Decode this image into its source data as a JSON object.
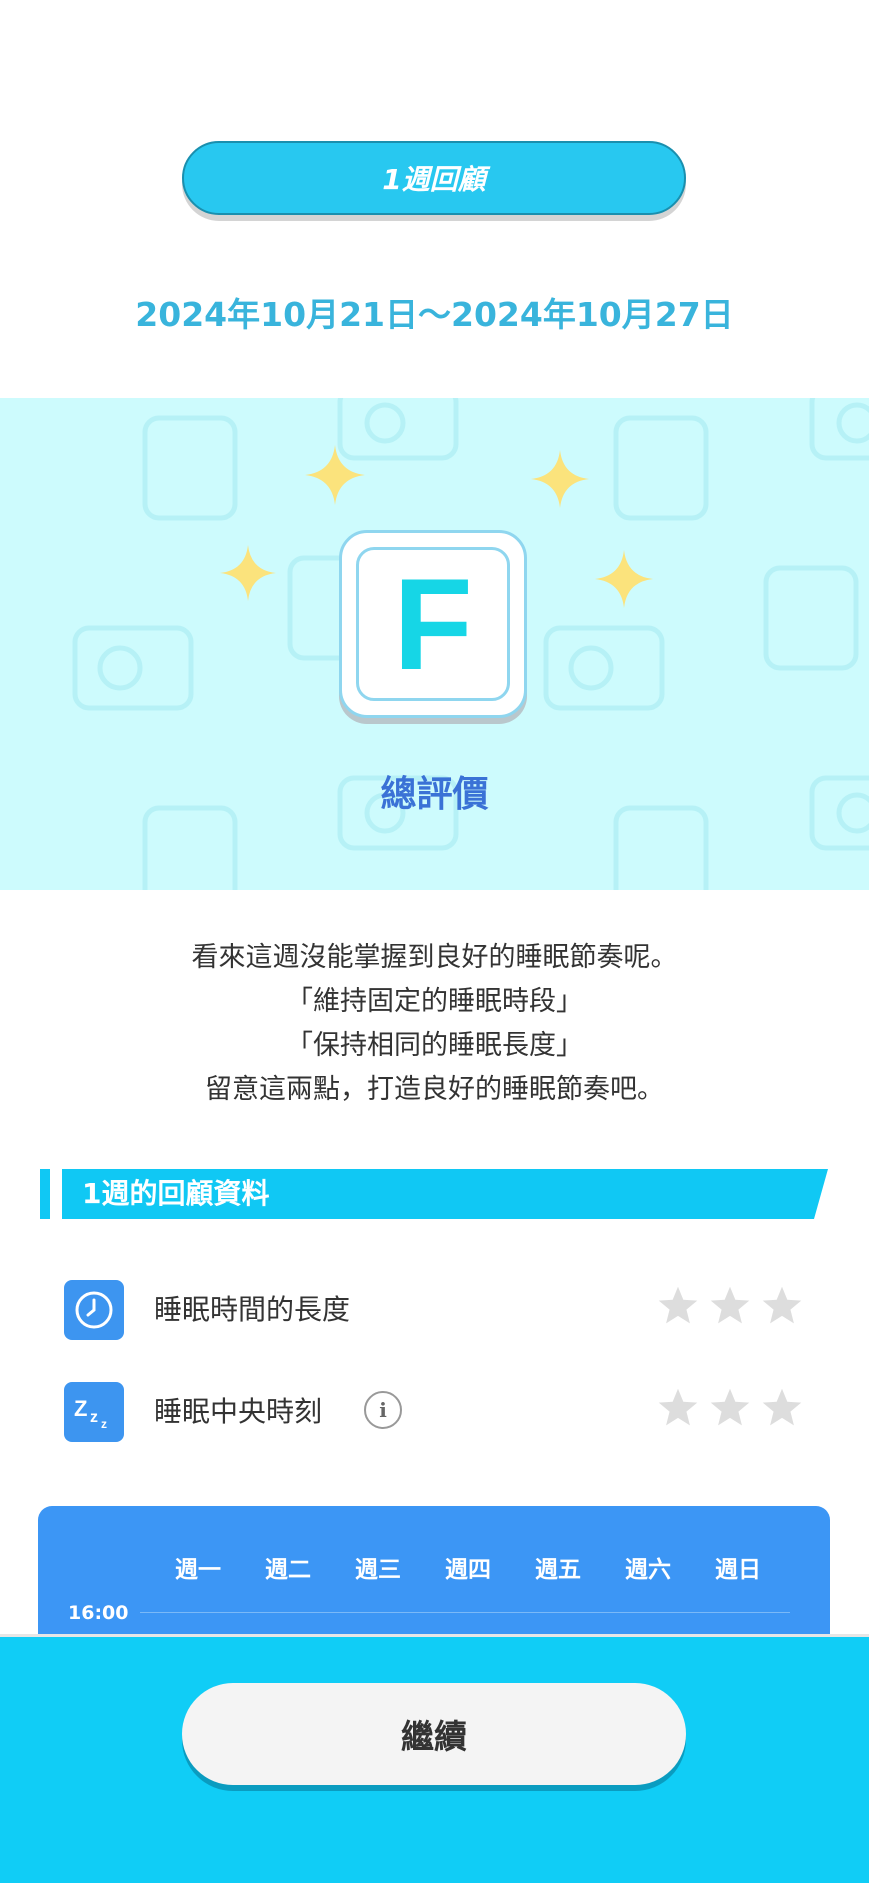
{
  "header": {
    "title": "1週回顧",
    "date_range": "2024年10月21日～2024年10月27日"
  },
  "grade": {
    "letter": "F",
    "label": "總評價"
  },
  "message": {
    "lines": [
      "看來這週沒能掌握到良好的睡眠節奏呢。",
      "「維持固定的睡眠時段」",
      "「保持相同的睡眠長度」",
      "留意這兩點，打造良好的睡眠節奏吧。"
    ]
  },
  "review": {
    "section_title": "1週的回顧資料",
    "metrics": [
      {
        "label": "睡眠時間的長度",
        "icon": "clock-icon",
        "stars_filled": 0,
        "stars_total": 3
      },
      {
        "label": "睡眠中央時刻",
        "icon": "zzz-icon",
        "info_icon": "i",
        "stars_filled": 0,
        "stars_total": 3
      }
    ]
  },
  "chart": {
    "days": [
      "週一",
      "週二",
      "週三",
      "週四",
      "週五",
      "週六",
      "週日"
    ],
    "time_label": "16:00"
  },
  "footer": {
    "continue_label": "繼續"
  },
  "colors": {
    "accent": "#28c8f0",
    "hero_bg": "#cdfbfd",
    "grade_letter": "#16d6e6",
    "chart_bg": "#3c96f5",
    "star_empty": "#dddddd",
    "bottom_bar": "#10cdf6"
  }
}
